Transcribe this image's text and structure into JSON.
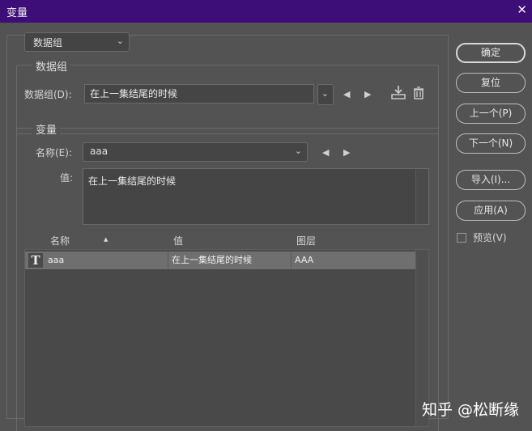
{
  "window": {
    "title": "变量",
    "close_icon": "close-icon"
  },
  "top_dropdown": {
    "value": "数据组"
  },
  "data_group": {
    "title": "数据组",
    "label": "数据组(D):",
    "value": "在上一集结尾的时候",
    "prev_icon": "arrow-left-icon",
    "next_icon": "arrow-right-icon",
    "import_icon": "import-icon",
    "trash_icon": "trash-icon"
  },
  "variable": {
    "title": "变量",
    "name_label": "名称(E):",
    "name_value": "aaa",
    "value_label": "值:",
    "value_text": "在上一集结尾的时候"
  },
  "table": {
    "headers": [
      "名称",
      "值",
      "图层"
    ],
    "sort_icon": "▲",
    "rows": [
      {
        "type_icon": "T",
        "name": "aaa",
        "value": "在上一集结尾的时候",
        "layer": "AAA"
      }
    ]
  },
  "buttons": {
    "ok": "确定",
    "reset": "复位",
    "prev": "上一个(P)",
    "next": "下一个(N)",
    "import": "导入(I)...",
    "apply": "应用(A)"
  },
  "preview": {
    "label": "预览(V)",
    "checked": false
  },
  "watermark": "知乎 @松断缘"
}
